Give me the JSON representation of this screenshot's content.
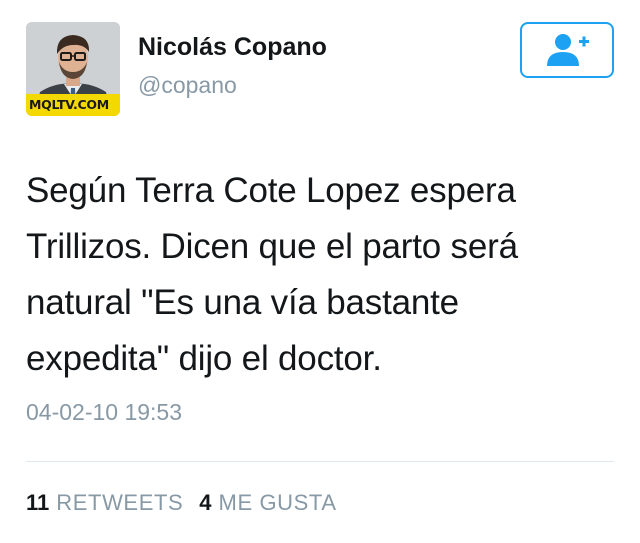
{
  "user": {
    "display_name": "Nicolás Copano",
    "handle": "@copano",
    "avatar_caption": "MQLTV.COM"
  },
  "follow_button": {
    "icon": "follow-person-plus-icon",
    "color": "#1da1f2"
  },
  "tweet": {
    "text": "Según Terra Cote Lopez espera\nTrillizos. Dicen que el parto será\nnatural \"Es una vía bastante\nexpedita\" dijo el doctor.",
    "timestamp": "04-02-10 19:53"
  },
  "stats": {
    "retweets": {
      "count": "11",
      "label": "RETWEETS"
    },
    "likes": {
      "count": "4",
      "label": "ME GUSTA"
    }
  },
  "colors": {
    "text": "#14171a",
    "secondary": "#8899a6",
    "accent": "#1da1f2",
    "divider": "#e1e8ed"
  }
}
